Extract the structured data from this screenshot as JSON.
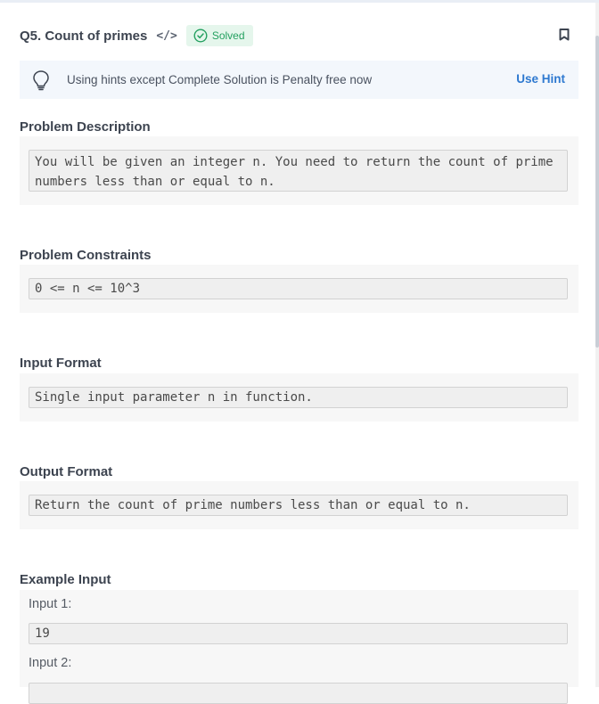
{
  "header": {
    "title": "Q5. Count of primes",
    "code_icon": "</>",
    "status": "Solved",
    "status_color": "#24a060",
    "icons": [
      "code-icon",
      "check-circle-icon",
      "bookmark-icon"
    ]
  },
  "hint": {
    "text": "Using hints except Complete Solution is Penalty free now",
    "action": "Use Hint",
    "action_color": "#2e79d0",
    "icon": "lightbulb-icon"
  },
  "sections": {
    "description": {
      "title": "Problem Description",
      "body": "You will be given an integer n. You need to return the count of prime numbers less than or equal to n."
    },
    "constraints": {
      "title": "Problem Constraints",
      "body": "0 <= n <= 10^3"
    },
    "input_format": {
      "title": "Input Format",
      "body": "Single input parameter n in function."
    },
    "output_format": {
      "title": "Output Format",
      "body": "Return the count of prime numbers less than or equal to n."
    },
    "example_input": {
      "title": "Example Input",
      "inputs": [
        {
          "label": "Input 1:",
          "value": "19"
        },
        {
          "label": "Input 2:",
          "value": ""
        }
      ]
    }
  }
}
